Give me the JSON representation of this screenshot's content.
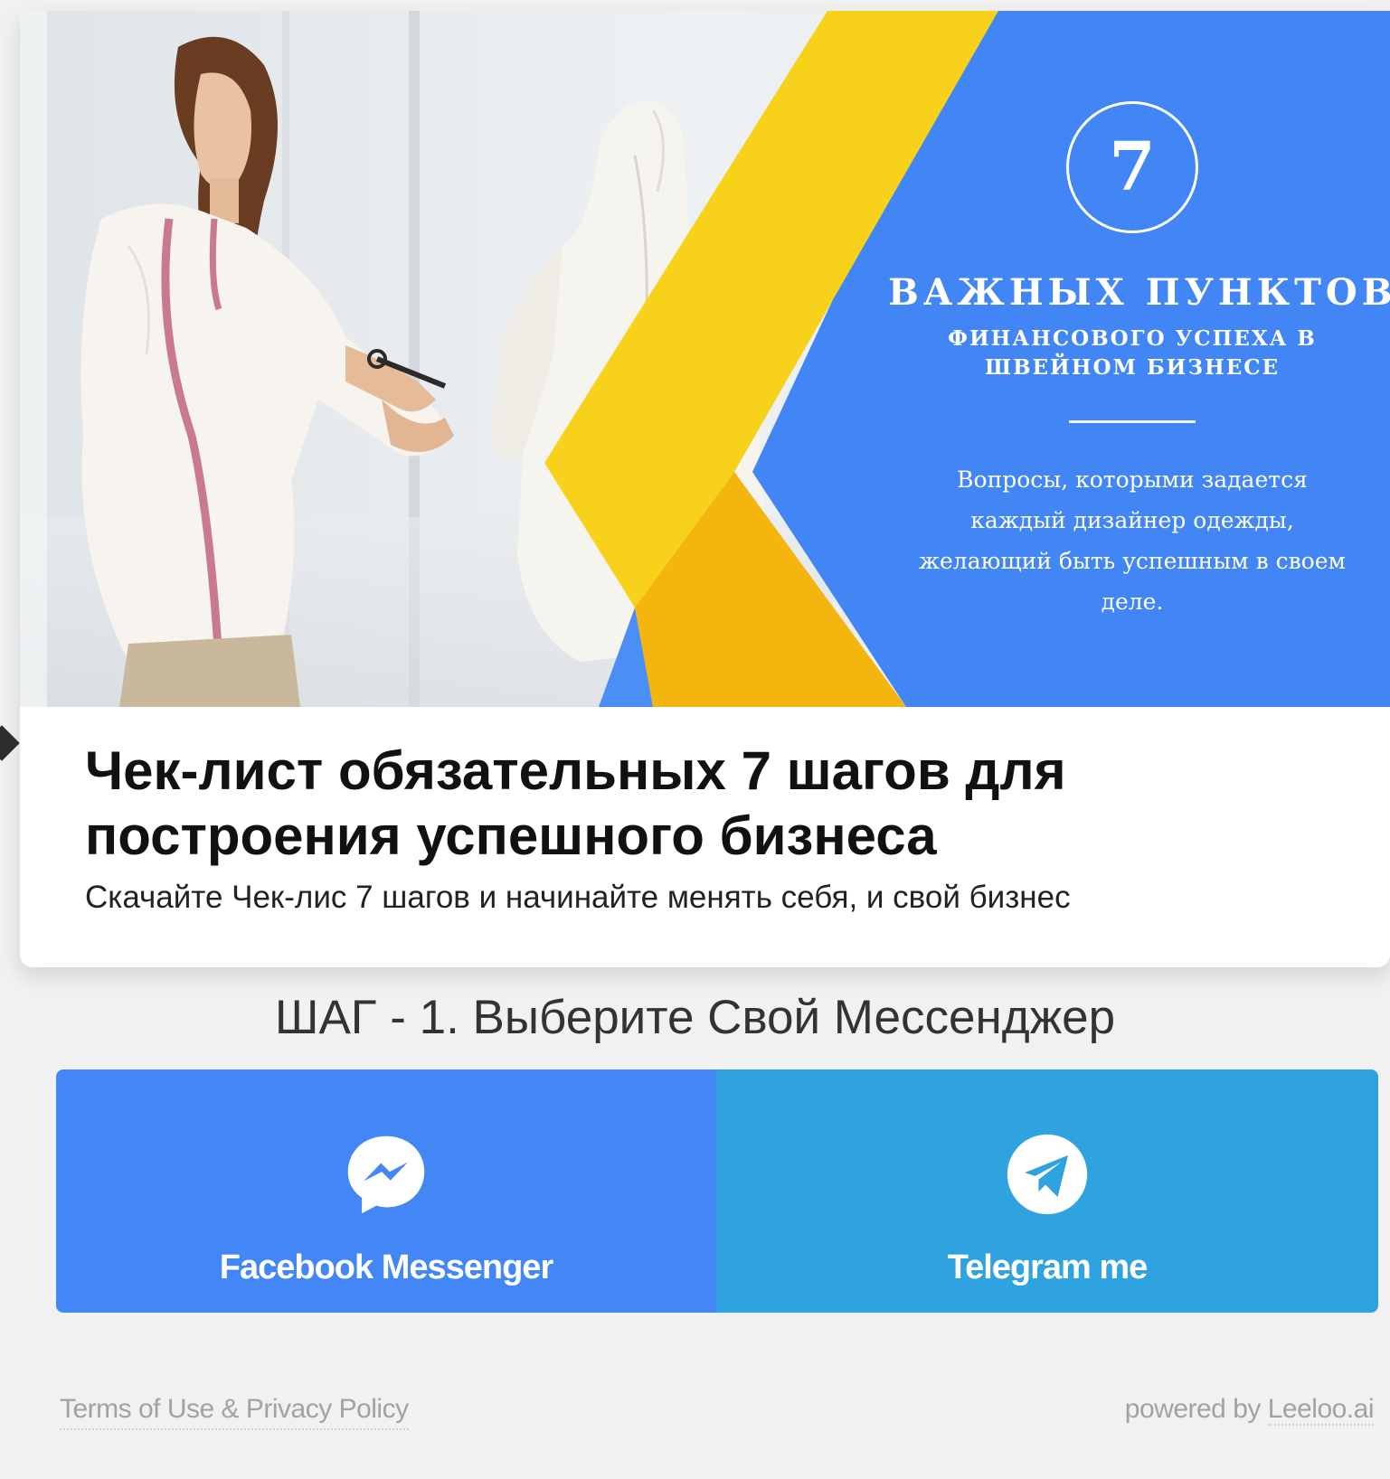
{
  "hero": {
    "number": "7",
    "heading": "ВАЖНЫХ ПУНКТОВ",
    "subheading": "ФИНАНСОВОГО УСПЕХА В ШВЕЙНОМ БИЗНЕСЕ",
    "description": "Вопросы, которыми задается каждый дизайнер одежды, желающий быть успешным в своем деле.",
    "colors": {
      "blue": "#4285f4",
      "yellow": "#f8d21a",
      "orange": "#f5b50f"
    }
  },
  "card": {
    "title": "Чек-лист обязательных 7 шагов для построения успешного бизнеса",
    "subtitle": "Скачайте Чек-лис 7 шагов и начинайте менять себя, и свой бизнес"
  },
  "step": {
    "title": "ШАГ - 1. Выберите Свой Мессенджер"
  },
  "buttons": {
    "facebook": {
      "label": "Facebook Messenger",
      "icon": "messenger-icon",
      "color": "#4287f5"
    },
    "telegram": {
      "label": "Telegram me",
      "icon": "telegram-icon",
      "color": "#2fa3e0"
    }
  },
  "footer": {
    "terms": "Terms of Use & Privacy Policy",
    "powered_prefix": "powered by ",
    "powered_brand": "Leeloo.ai"
  }
}
